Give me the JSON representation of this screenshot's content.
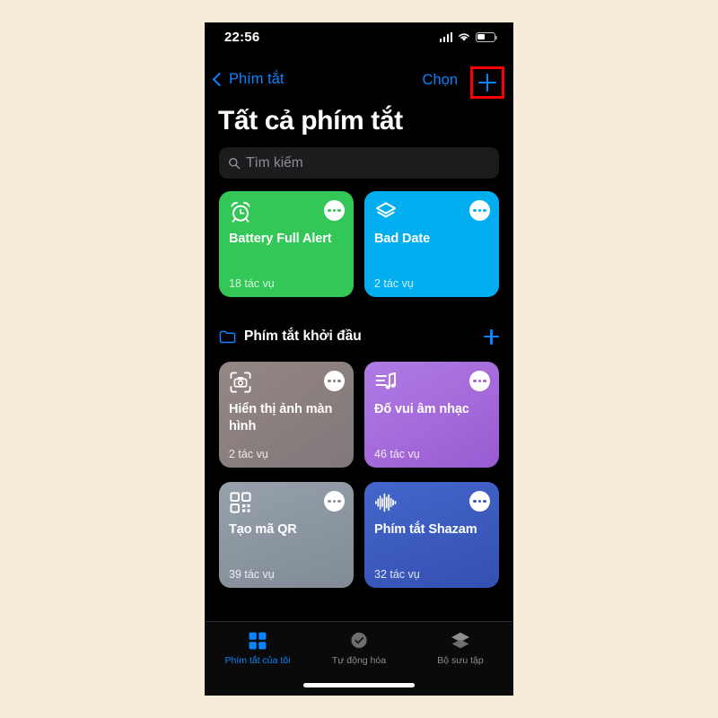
{
  "page": {
    "background_color": "#f7ecd9",
    "screen_background": "#000000"
  },
  "status_bar": {
    "time": "22:56",
    "cellular_icon": "cellular-bars-icon",
    "wifi_icon": "wifi-icon",
    "battery_icon": "battery-icon"
  },
  "nav_bar": {
    "back_label": "Phím tắt",
    "back_icon": "chevron-left-icon",
    "select_label": "Chọn",
    "add_icon": "plus-icon",
    "highlight_color": "#ff0000",
    "accent_color": "#0a84ff"
  },
  "header": {
    "title": "Tất cả phím tắt"
  },
  "search": {
    "placeholder": "Tìm kiếm",
    "icon": "search-icon"
  },
  "top_shortcuts": [
    {
      "title": "Battery Full Alert",
      "subtitle": "18 tác vụ",
      "color": "#32c757",
      "icon": "alarm-clock-icon",
      "more_icon": "more-ellipsis-icon"
    },
    {
      "title": "Bad Date",
      "subtitle": "2 tác vụ",
      "color": "#02aeef",
      "icon": "layers-stack-icon",
      "more_icon": "more-ellipsis-icon"
    }
  ],
  "section": {
    "title": "Phím tắt khởi đầu",
    "folder_icon": "folder-icon",
    "add_icon": "plus-icon"
  },
  "starter_shortcuts": [
    {
      "title": "Hiển thị ảnh màn hình",
      "subtitle": "2 tác vụ",
      "color": "#8b807e",
      "icon": "camera-viewfinder-icon",
      "more_icon": "more-ellipsis-icon"
    },
    {
      "title": "Đố vui âm nhạc",
      "subtitle": "46 tác vụ",
      "color": "#a364db",
      "icon": "music-list-icon",
      "more_icon": "more-ellipsis-icon"
    },
    {
      "title": "Tạo mã QR",
      "subtitle": "39 tác vụ",
      "color": "#8b95a0",
      "icon": "qr-code-icon",
      "more_icon": "more-ellipsis-icon"
    },
    {
      "title": "Phím tắt Shazam",
      "subtitle": "32 tác vụ",
      "color": "#3b5bbe",
      "icon": "waveform-icon",
      "more_icon": "more-ellipsis-icon"
    }
  ],
  "tab_bar": {
    "active_color": "#0a84ff",
    "inactive_color": "#8e8e93",
    "tabs": [
      {
        "label": "Phím tắt của tôi",
        "icon": "grid-squares-icon",
        "active": true
      },
      {
        "label": "Tự động hóa",
        "icon": "clock-check-icon",
        "active": false
      },
      {
        "label": "Bộ sưu tập",
        "icon": "layers-stack-icon",
        "active": false
      }
    ]
  }
}
